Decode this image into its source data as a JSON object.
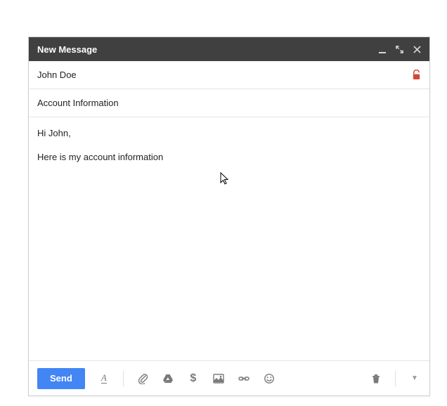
{
  "titlebar": {
    "title": "New Message"
  },
  "fields": {
    "to": "John Doe",
    "subject": "Account Information"
  },
  "body": {
    "line1": "Hi John,",
    "line2": "Here is my account information"
  },
  "toolbar": {
    "send_label": "Send"
  }
}
